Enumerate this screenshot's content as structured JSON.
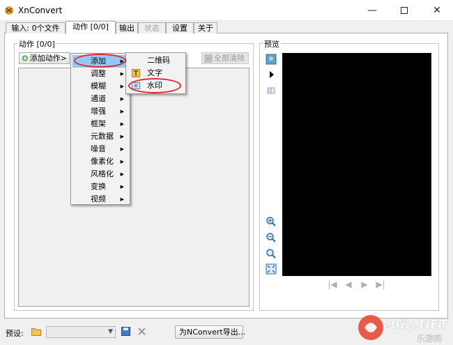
{
  "window": {
    "title": "XnConvert"
  },
  "tabs": [
    {
      "label": "输入: 0个文件"
    },
    {
      "label": "动作 [0/0]"
    },
    {
      "label": "输出"
    },
    {
      "label": "状态"
    },
    {
      "label": "设置"
    },
    {
      "label": "关于"
    }
  ],
  "actions_panel": {
    "title": "动作 [0/0]",
    "add_action_label": "添加动作>",
    "clear_all_label": "全部清除"
  },
  "preview_panel": {
    "title": "预览"
  },
  "context_menu": {
    "items": [
      {
        "label": "添加",
        "submenu": true,
        "highlighted": true
      },
      {
        "label": "调整",
        "submenu": true
      },
      {
        "label": "模糊",
        "submenu": true
      },
      {
        "label": "通道",
        "submenu": true
      },
      {
        "label": "增强",
        "submenu": true
      },
      {
        "label": "框架",
        "submenu": true
      },
      {
        "label": "元数据",
        "submenu": true
      },
      {
        "label": "噪音",
        "submenu": true
      },
      {
        "label": "像素化",
        "submenu": true
      },
      {
        "label": "风格化",
        "submenu": true
      },
      {
        "label": "变换",
        "submenu": true
      },
      {
        "label": "视频",
        "submenu": true
      }
    ],
    "submenu": [
      {
        "label": "二维码"
      },
      {
        "label": "文字"
      },
      {
        "label": "水印"
      }
    ]
  },
  "bottom_bar": {
    "preset_label": "预设:",
    "export_button_label": "为NConvert导出..."
  },
  "watermark": {
    "brand": "962.NET",
    "subtitle": "乐游网"
  },
  "colors": {
    "menu_highlight": "#91c9f7",
    "annotation_red": "#e0262b",
    "preview_bg": "#000000"
  }
}
